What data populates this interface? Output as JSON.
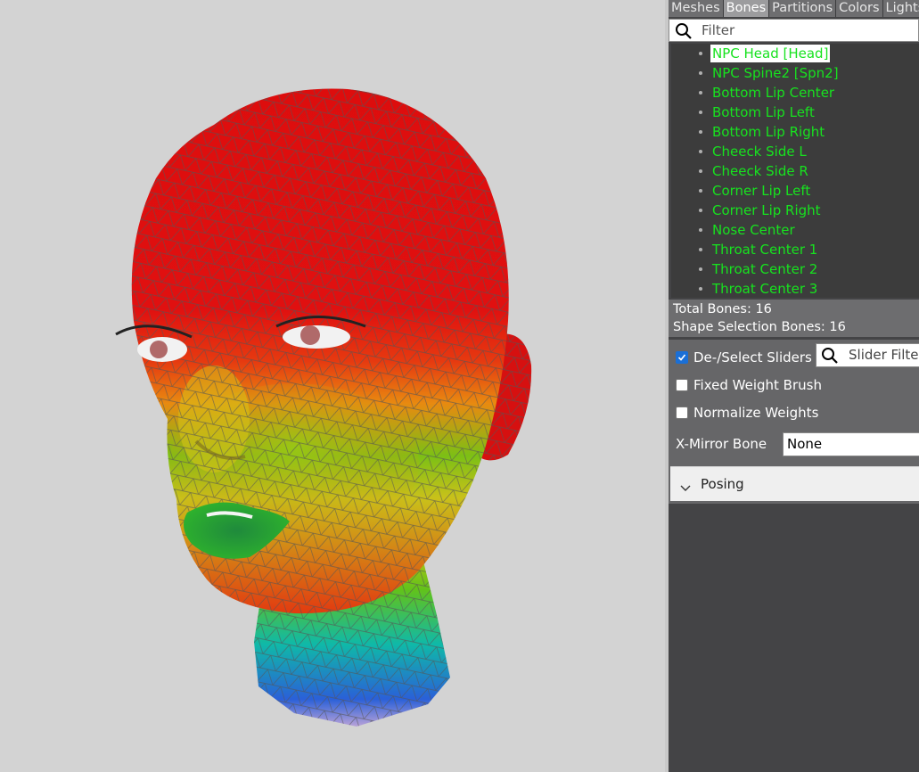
{
  "tabs": [
    "Meshes",
    "Bones",
    "Partitions",
    "Colors",
    "Lights"
  ],
  "active_tab": "Bones",
  "bone_filter": {
    "placeholder": "Filter",
    "icon": "search-icon"
  },
  "bones": [
    "NPC Head [Head]",
    "NPC Spine2 [Spn2]",
    "Bottom Lip Center",
    "Bottom Lip Left",
    "Bottom Lip Right",
    "Cheeck Side L",
    "Cheeck Side R",
    "Corner Lip Left",
    "Corner Lip Right",
    "Nose Center",
    "Throat Center 1",
    "Throat Center 2",
    "Throat Center 3"
  ],
  "selected_bone": "NPC Head [Head]",
  "stats": {
    "total_bones": "Total Bones: 16",
    "shape_selection_bones": "Shape Selection Bones: 16"
  },
  "options": {
    "deselect_sliders": {
      "label": "De-/Select Sliders",
      "checked": true
    },
    "fixed_weight_brush": {
      "label": "Fixed Weight Brush",
      "checked": false
    },
    "normalize_weights": {
      "label": "Normalize Weights",
      "checked": false
    },
    "slider_filter": {
      "placeholder": "Slider Filter"
    },
    "x_mirror_bone": {
      "label": "X-Mirror Bone",
      "value": "None"
    }
  },
  "posing": {
    "label": "Posing"
  },
  "colors": {
    "bone_text": "#17e21f",
    "panel_bg": "#444446",
    "viewport_bg": "#d3d3d3",
    "checkbox_accent": "#1a6fd6"
  }
}
